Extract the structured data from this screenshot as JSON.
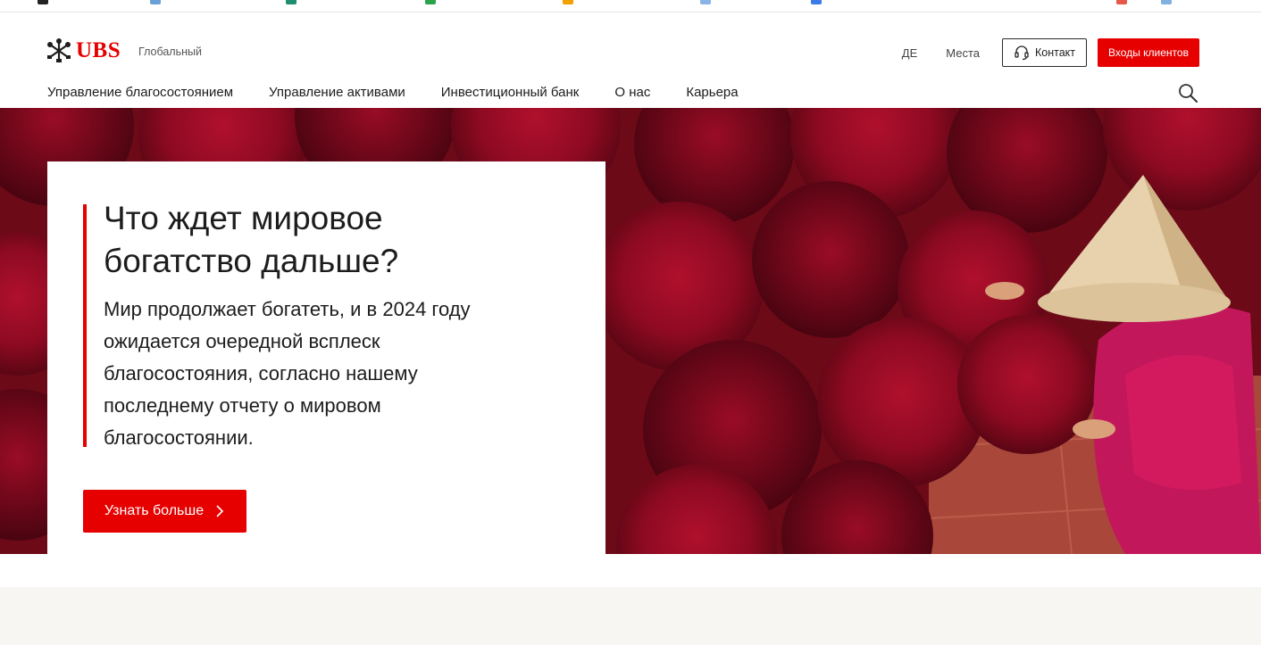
{
  "brand": {
    "logo_text": "UBS",
    "region": "Глобальный",
    "accent_color": "#e60000"
  },
  "utility_nav": {
    "language": "ДЕ",
    "locations": "Места",
    "contact": "Контакт",
    "login": "Входы клиентов",
    "contact_icon": "headset-icon"
  },
  "main_nav": {
    "items": [
      "Управление благосостоянием",
      "Управление активами",
      "Инвестиционный банк",
      "О нас",
      "Карьера"
    ],
    "search_icon": "search-icon"
  },
  "hero": {
    "title": "Что ждет мировое богатство дальше?",
    "text": "Мир продолжает богатеть, и в 2024 году ожидается очередной всплеск благосостояния, согласно нашему последнему отчету о мировом благосостоянии.",
    "cta": "Узнать больше",
    "cta_icon": "chevron-right-icon"
  }
}
